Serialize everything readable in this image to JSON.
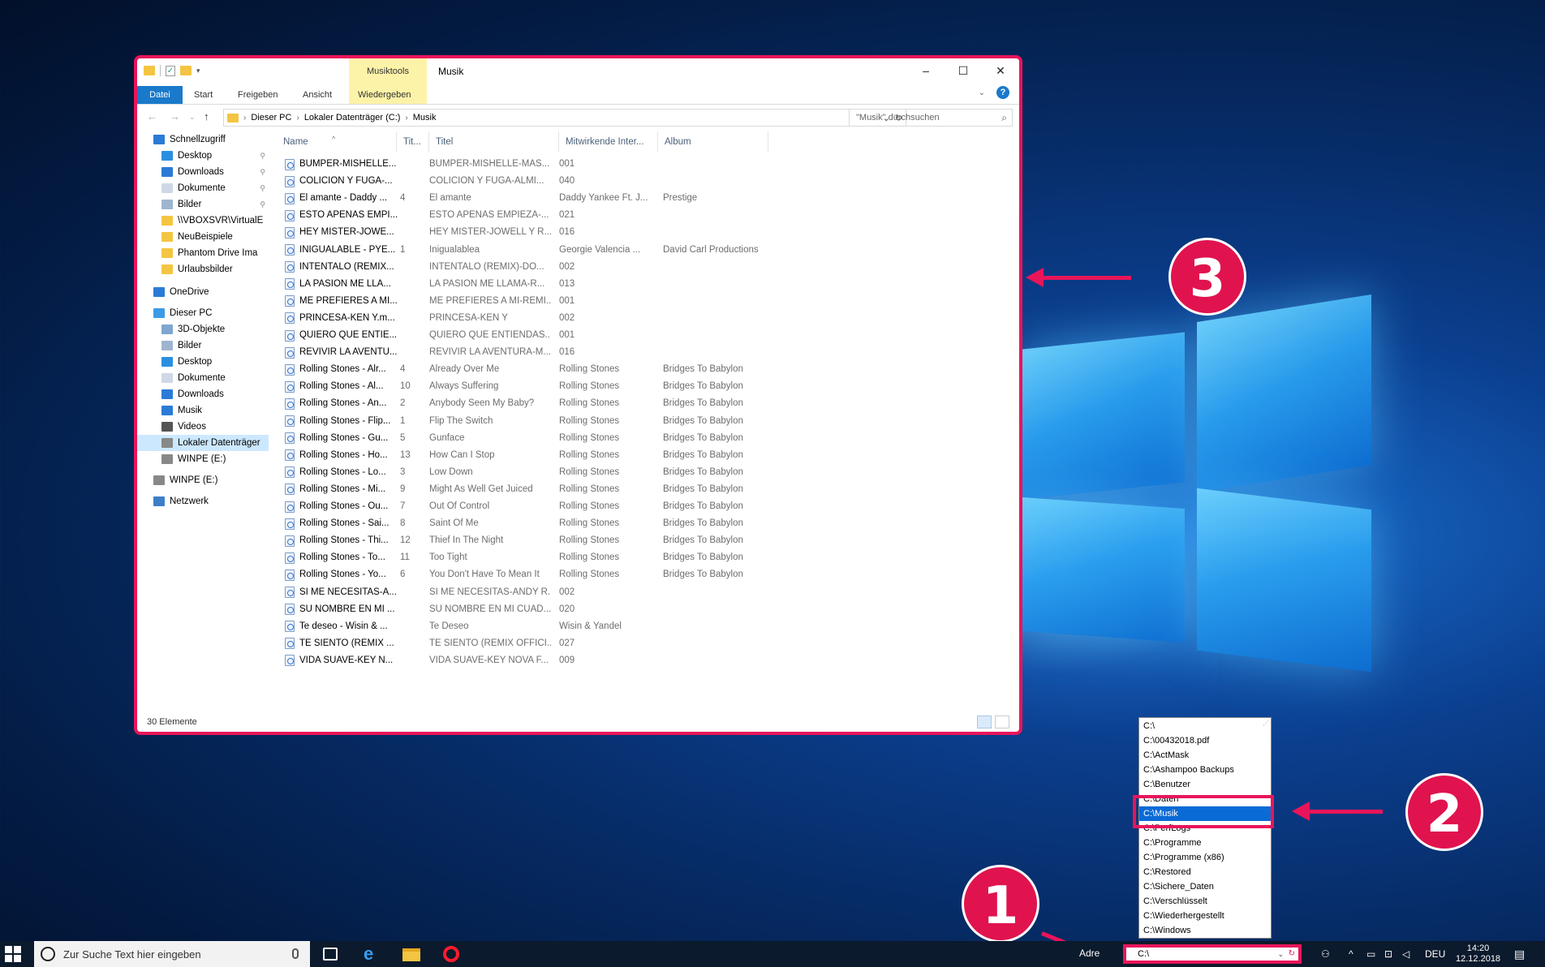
{
  "window": {
    "title": "Musik",
    "context_tab": "Musiktools",
    "minimize": "–",
    "maximize": "☐",
    "close": "✕",
    "ribbon_tabs": [
      "Datei",
      "Start",
      "Freigeben",
      "Ansicht",
      "Wiedergeben"
    ],
    "help": "?"
  },
  "address": {
    "crumbs": [
      "Dieser PC",
      "Lokaler Datenträger (C:)",
      "Musik"
    ],
    "search_placeholder": "\"Musik\" durchsuchen"
  },
  "sidebar": [
    {
      "label": "Schnellzugriff",
      "icon": "star-icon",
      "indent": 0,
      "pinned": false
    },
    {
      "label": "Desktop",
      "icon": "desktop-icon",
      "indent": 1,
      "pinned": true
    },
    {
      "label": "Downloads",
      "icon": "download-icon",
      "indent": 1,
      "pinned": true
    },
    {
      "label": "Dokumente",
      "icon": "document-icon",
      "indent": 1,
      "pinned": true
    },
    {
      "label": "Bilder",
      "icon": "pictures-icon",
      "indent": 1,
      "pinned": true
    },
    {
      "label": "\\\\VBOXSVR\\VirtualE",
      "icon": "folder-icon",
      "indent": 1,
      "pinned": false
    },
    {
      "label": "NeuBeispiele",
      "icon": "folder-icon",
      "indent": 1,
      "pinned": false
    },
    {
      "label": "Phantom Drive Ima",
      "icon": "folder-icon",
      "indent": 1,
      "pinned": false
    },
    {
      "label": "Urlaubsbilder",
      "icon": "folder-icon",
      "indent": 1,
      "pinned": false
    },
    {
      "label": "OneDrive",
      "icon": "cloud-icon",
      "indent": 0,
      "pinned": false
    },
    {
      "label": "Dieser PC",
      "icon": "computer-icon",
      "indent": 0,
      "pinned": false
    },
    {
      "label": "3D-Objekte",
      "icon": "cube-icon",
      "indent": 1,
      "pinned": false
    },
    {
      "label": "Bilder",
      "icon": "pictures-icon",
      "indent": 1,
      "pinned": false
    },
    {
      "label": "Desktop",
      "icon": "desktop-icon",
      "indent": 1,
      "pinned": false
    },
    {
      "label": "Dokumente",
      "icon": "document-icon",
      "indent": 1,
      "pinned": false
    },
    {
      "label": "Downloads",
      "icon": "download-icon",
      "indent": 1,
      "pinned": false
    },
    {
      "label": "Musik",
      "icon": "music-icon",
      "indent": 1,
      "pinned": false
    },
    {
      "label": "Videos",
      "icon": "video-icon",
      "indent": 1,
      "pinned": false
    },
    {
      "label": "Lokaler Datenträger",
      "icon": "drive-icon",
      "indent": 1,
      "pinned": false,
      "selected": true
    },
    {
      "label": "WINPE (E:)",
      "icon": "drive-icon",
      "indent": 1,
      "pinned": false
    },
    {
      "label": "WINPE (E:)",
      "icon": "drive-icon",
      "indent": 0,
      "pinned": false
    },
    {
      "label": "Netzwerk",
      "icon": "network-icon",
      "indent": 0,
      "pinned": false
    }
  ],
  "columns": [
    "Name",
    "Tit...",
    "Titel",
    "Mitwirkende Inter...",
    "Album"
  ],
  "files": [
    [
      "BUMPER-MISHELLE...",
      "",
      "BUMPER-MISHELLE-MAS...",
      "001",
      ""
    ],
    [
      "COLICION Y FUGA-...",
      "",
      "COLICION Y FUGA-ALMI...",
      "040",
      ""
    ],
    [
      "El amante - Daddy ...",
      "4",
      "El amante",
      "Daddy Yankee Ft. J...",
      "Prestige"
    ],
    [
      "ESTO APENAS EMPI...",
      "",
      "ESTO APENAS EMPIEZA-...",
      "021",
      ""
    ],
    [
      "HEY MISTER-JOWE...",
      "",
      "HEY MISTER-JOWELL Y R...",
      "016",
      ""
    ],
    [
      "INIGUALABLE - PYE...",
      "1",
      "Inigualablea",
      "Georgie Valencia ...",
      "David Carl Productions"
    ],
    [
      "INTENTALO (REMIX...",
      "",
      "INTENTALO (REMIX)-DO...",
      "002",
      ""
    ],
    [
      "LA PASION ME LLA...",
      "",
      "LA PASION ME LLAMA-R...",
      "013",
      ""
    ],
    [
      "ME PREFIERES A MI...",
      "",
      "ME PREFIERES A MI-REMI...",
      "001",
      ""
    ],
    [
      "PRINCESA-KEN Y.m...",
      "",
      "PRINCESA-KEN Y",
      "002",
      ""
    ],
    [
      "QUIERO QUE ENTIE...",
      "",
      "QUIERO QUE ENTIENDAS...",
      "001",
      ""
    ],
    [
      "REVIVIR LA AVENTU...",
      "",
      "REVIVIR LA AVENTURA-M...",
      "016",
      ""
    ],
    [
      "Rolling Stones - Alr...",
      "4",
      "Already Over Me",
      "Rolling Stones",
      "Bridges To Babylon"
    ],
    [
      "Rolling Stones - Al...",
      "10",
      "Always Suffering",
      "Rolling Stones",
      "Bridges To Babylon"
    ],
    [
      "Rolling Stones - An...",
      "2",
      "Anybody Seen My Baby?",
      "Rolling Stones",
      "Bridges To Babylon"
    ],
    [
      "Rolling Stones - Flip...",
      "1",
      "Flip The Switch",
      "Rolling Stones",
      "Bridges To Babylon"
    ],
    [
      "Rolling Stones - Gu...",
      "5",
      "Gunface",
      "Rolling Stones",
      "Bridges To Babylon"
    ],
    [
      "Rolling Stones - Ho...",
      "13",
      "How Can I Stop",
      "Rolling Stones",
      "Bridges To Babylon"
    ],
    [
      "Rolling Stones - Lo...",
      "3",
      "Low Down",
      "Rolling Stones",
      "Bridges To Babylon"
    ],
    [
      "Rolling Stones - Mi...",
      "9",
      "Might As Well Get Juiced",
      "Rolling Stones",
      "Bridges To Babylon"
    ],
    [
      "Rolling Stones - Ou...",
      "7",
      "Out Of Control",
      "Rolling Stones",
      "Bridges To Babylon"
    ],
    [
      "Rolling Stones - Sai...",
      "8",
      "Saint Of Me",
      "Rolling Stones",
      "Bridges To Babylon"
    ],
    [
      "Rolling Stones - Thi...",
      "12",
      "Thief In The Night",
      "Rolling Stones",
      "Bridges To Babylon"
    ],
    [
      "Rolling Stones - To...",
      "11",
      "Too Tight",
      "Rolling Stones",
      "Bridges To Babylon"
    ],
    [
      "Rolling Stones - Yo...",
      "6",
      "You Don't Have To Mean It",
      "Rolling Stones",
      "Bridges To Babylon"
    ],
    [
      "SI ME NECESITAS-A...",
      "",
      "SI ME NECESITAS-ANDY R...",
      "002",
      ""
    ],
    [
      "SU NOMBRE EN MI ...",
      "",
      "SU NOMBRE EN MI CUAD...",
      "020",
      ""
    ],
    [
      "Te deseo - Wisin & ...",
      "",
      "Te Deseo",
      "Wisin & Yandel",
      ""
    ],
    [
      "TE SIENTO (REMIX ...",
      "",
      "TE SIENTO (REMIX OFFICI...",
      "027",
      ""
    ],
    [
      "VIDA SUAVE-KEY N...",
      "",
      "VIDA SUAVE-KEY NOVA F...",
      "009",
      ""
    ]
  ],
  "status": "30 Elemente",
  "dropdown": {
    "items": [
      "C:\\",
      "C:\\00432018.pdf",
      "C:\\ActMask",
      "C:\\Ashampoo Backups",
      "C:\\Benutzer",
      "C:\\Daten",
      "C:\\Musik",
      "C:\\PerfLogs",
      "C:\\Programme",
      "C:\\Programme (x86)",
      "C:\\Restored",
      "C:\\Sichere_Daten",
      "C:\\Verschlüsselt",
      "C:\\Wiederhergestellt",
      "C:\\Windows"
    ],
    "selected_index": 6
  },
  "annotations": {
    "badge1": "1",
    "badge2": "2",
    "badge3": "3",
    "accent": "#e8155a"
  },
  "taskbar": {
    "search_placeholder": "Zur Suche Text hier eingeben",
    "address_label": "Adre",
    "address_value": "C:\\",
    "language": "DEU",
    "time": "14:20",
    "date": "12.12.2018"
  }
}
